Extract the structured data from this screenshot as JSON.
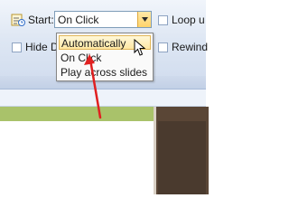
{
  "ribbon": {
    "start_label": "Start:",
    "start_value": "On Click",
    "loop_label": "Loop u",
    "hide_label": "Hide D",
    "rewind_label": "Rewind"
  },
  "dropdown": {
    "options": [
      "Automatically",
      "On Click",
      "Play across slides"
    ],
    "highlighted": "Automatically"
  },
  "colors": {
    "highlight": "#ffe7a2",
    "annotation_arrow": "#e02020",
    "slide_band": "#a9c26a"
  },
  "icons": [
    "start-timing-icon",
    "chevron-down-icon",
    "mouse-cursor-icon"
  ]
}
